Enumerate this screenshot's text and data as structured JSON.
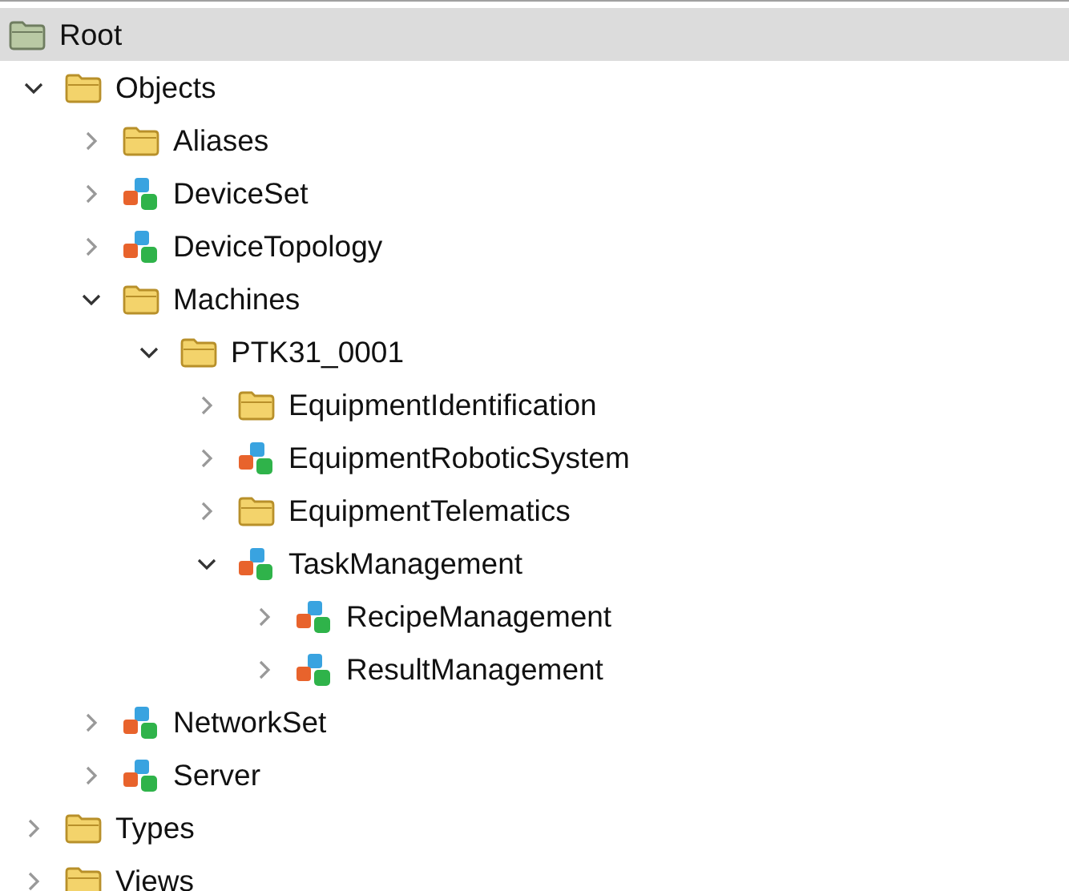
{
  "tree": {
    "label": "Root",
    "selected": true,
    "children": [
      {
        "label": "Objects",
        "kind": "folder",
        "expanded": true,
        "selected": false,
        "children": [
          {
            "label": "Aliases",
            "kind": "folder",
            "expanded": false,
            "selected": false
          },
          {
            "label": "DeviceSet",
            "kind": "object",
            "expanded": false,
            "selected": false
          },
          {
            "label": "DeviceTopology",
            "kind": "object",
            "expanded": false,
            "selected": false
          },
          {
            "label": "Machines",
            "kind": "folder",
            "expanded": true,
            "selected": false,
            "children": [
              {
                "label": "PTK31_0001",
                "kind": "folder",
                "expanded": true,
                "selected": false,
                "children": [
                  {
                    "label": "EquipmentIdentification",
                    "kind": "folder",
                    "expanded": false,
                    "selected": false
                  },
                  {
                    "label": "EquipmentRoboticSystem",
                    "kind": "object",
                    "expanded": false,
                    "selected": false
                  },
                  {
                    "label": "EquipmentTelematics",
                    "kind": "folder",
                    "expanded": false,
                    "selected": false
                  },
                  {
                    "label": "TaskManagement",
                    "kind": "object",
                    "expanded": true,
                    "selected": false,
                    "children": [
                      {
                        "label": "RecipeManagement",
                        "kind": "object",
                        "expanded": false,
                        "selected": false
                      },
                      {
                        "label": "ResultManagement",
                        "kind": "object",
                        "expanded": false,
                        "selected": false
                      }
                    ]
                  }
                ]
              }
            ]
          },
          {
            "label": "NetworkSet",
            "kind": "object",
            "expanded": false,
            "selected": false
          },
          {
            "label": "Server",
            "kind": "object",
            "expanded": false,
            "selected": false
          }
        ]
      },
      {
        "label": "Types",
        "kind": "folder",
        "expanded": false,
        "selected": false
      },
      {
        "label": "Views",
        "kind": "folder",
        "expanded": false,
        "selected": false
      }
    ]
  }
}
